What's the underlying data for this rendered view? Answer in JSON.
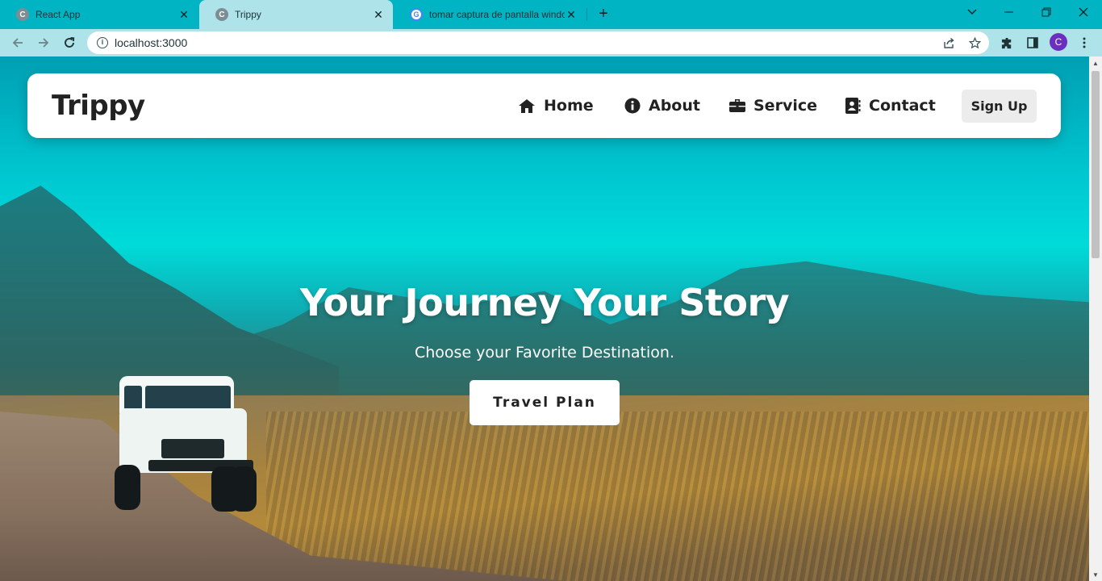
{
  "browser": {
    "tabs": [
      {
        "title": "React App",
        "favicon": "chromium-icon",
        "active": false
      },
      {
        "title": "Trippy",
        "favicon": "chromium-icon",
        "active": true
      },
      {
        "title": "tomar captura de pantalla windo",
        "favicon": "google-icon",
        "active": false
      }
    ],
    "new_tab_glyph": "+",
    "address": "localhost:3000",
    "profile_initial": "C"
  },
  "site": {
    "logo": "Trippy",
    "nav": [
      {
        "label": "Home",
        "icon": "house-icon"
      },
      {
        "label": "About",
        "icon": "info-circle-icon"
      },
      {
        "label": "Service",
        "icon": "briefcase-icon"
      },
      {
        "label": "Contact",
        "icon": "address-book-icon"
      }
    ],
    "signup_label": "Sign Up",
    "hero": {
      "title": "Your Journey Your Story",
      "subtitle": "Choose your Favorite Destination.",
      "button_label": "Travel Plan"
    }
  },
  "colors": {
    "chrome_frame": "#00b4c4",
    "chrome_toolbar": "#aee3ea",
    "nav_background": "#ffffff",
    "signup_background": "#ececec",
    "text_dark": "#222222"
  }
}
